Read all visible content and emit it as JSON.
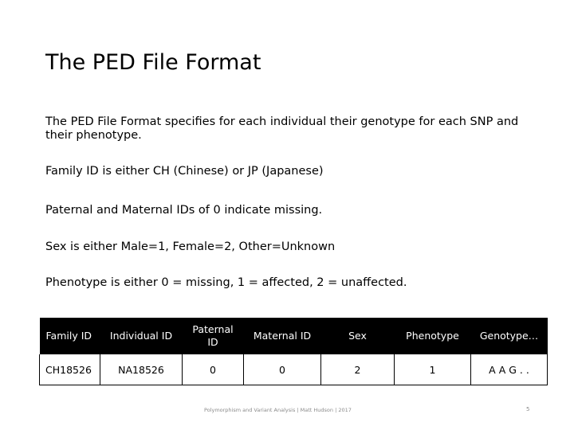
{
  "slide": {
    "title": "The PED File Format",
    "paragraphs": [
      "The PED File Format specifies for each individual their genotype for each SNP and their phenotype.",
      "Family ID is either CH (Chinese) or JP (Japanese)",
      "Paternal and Maternal IDs of 0 indicate missing.",
      "Sex is either Male=1, Female=2, Other=Unknown",
      "Phenotype is either 0 = missing, 1 = affected, 2 = unaffected."
    ],
    "table": {
      "headers": [
        "Family ID",
        "Individual ID",
        "Paternal ID",
        "Maternal ID",
        "Sex",
        "Phenotype",
        "Genotype…"
      ],
      "rows": [
        [
          "CH18526",
          "NA18526",
          "0",
          "0",
          "2",
          "1",
          "A A G . ."
        ]
      ]
    },
    "footer": "Polymorphism and Variant Analysis | Matt Hudson | 2017",
    "page_number": "5"
  },
  "colors": {
    "table_header_bg": "#000000",
    "table_header_text": "#ffffff",
    "footer_text": "#8a8a8a"
  }
}
